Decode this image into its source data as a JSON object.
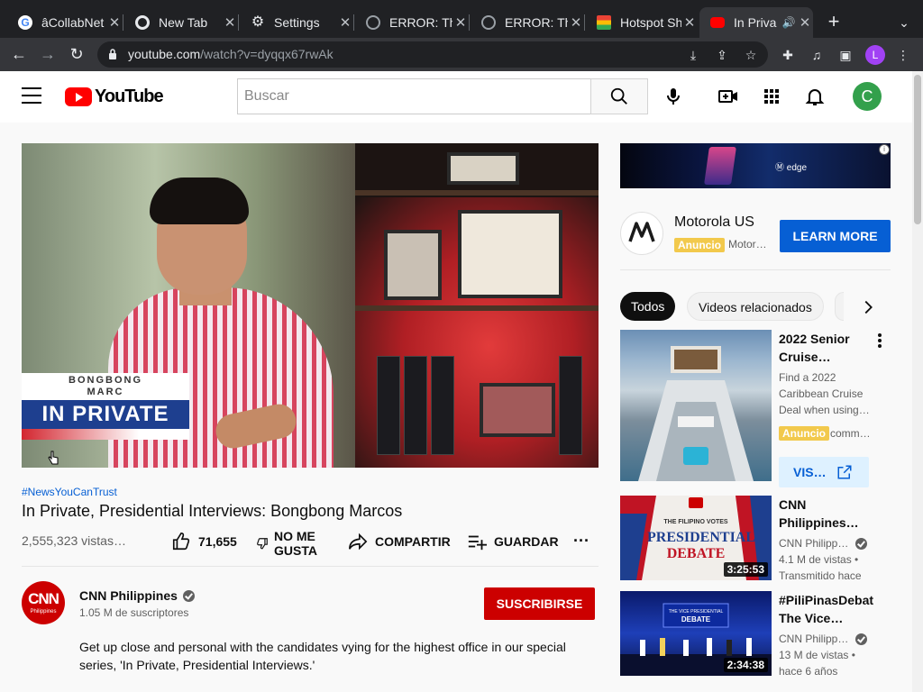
{
  "browser": {
    "tabs": [
      {
        "title": "âCollabNet",
        "favicon_color": "#4285f4"
      },
      {
        "title": "New Tab",
        "favicon_color": "#e8eaed"
      },
      {
        "title": "Settings",
        "favicon_color": "#e8eaed"
      },
      {
        "title": "ERROR: Th",
        "favicon_color": "#9aa0a6"
      },
      {
        "title": "ERROR: Th",
        "favicon_color": "#9aa0a6"
      },
      {
        "title": "Hotspot Sh",
        "favicon_color": "#f4b400"
      },
      {
        "title": "In Priva",
        "favicon_color": "#ff0000"
      }
    ],
    "active_tab": 6,
    "url_domain": "youtube.com",
    "url_path": "/watch?v=dyqqx67rwAk",
    "profile_initial": "L"
  },
  "youtube": {
    "logo_text": "YouTube",
    "search_placeholder": "Buscar",
    "account_initial": "C"
  },
  "video": {
    "lower_third_top": "BONGBONG\nMARC",
    "lower_third_bottom": "IN PRIVATE",
    "hashtag": "#NewsYouCanTrust",
    "title": "In Private, Presidential Interviews: Bongbong Marcos",
    "views": "2,555,323 vistas…",
    "likes": "71,655",
    "dislike_label": "NO ME GUSTA",
    "share_label": "COMPARTIR",
    "save_label": "GUARDAR"
  },
  "channel": {
    "avatar_text": "CNN",
    "avatar_sub": "Philippines",
    "name": "CNN Philippines",
    "subscribers": "1.05 M de suscriptores",
    "subscribe_label": "SUSCRIBIRSE",
    "description": "Get up close and personal with the candidates vying for the highest office in our special series, 'In Private, Presidential Interviews.'"
  },
  "sidebar": {
    "banner_text": "edge",
    "ad_info": "i",
    "advertiser": "Motorola US",
    "ad_badge": "Anuncio",
    "advertiser_sub": "Motor…",
    "learn_more": "LEARN MORE",
    "chips": [
      "Todos",
      "Videos relacionados"
    ],
    "items": [
      {
        "title": "2022 Senior Cruise…",
        "meta1": "Find a 2022 Caribbean Cruise Deal when using…",
        "badge": "Anuncio",
        "meta2": "comm…",
        "visit": "VIS…"
      },
      {
        "title": "CNN Philippines…",
        "channel": "CNN Philipp…",
        "meta1": "4.1 M de vistas •",
        "meta2": "Transmitido hace",
        "duration": "3:25:53",
        "thumb_text1": "THE FILIPINO VOTES",
        "thumb_text2": "PRESIDENTIAL",
        "thumb_text3": "DEBATE"
      },
      {
        "title": "#PiliPinasDebat The Vice…",
        "channel": "CNN Philipp…",
        "meta1": "13 M de vistas •",
        "meta2": "hace 6 años",
        "duration": "2:34:38",
        "thumb_text1": "THE VICE PRESIDENTIAL",
        "thumb_text2": "DEBATE"
      }
    ]
  }
}
